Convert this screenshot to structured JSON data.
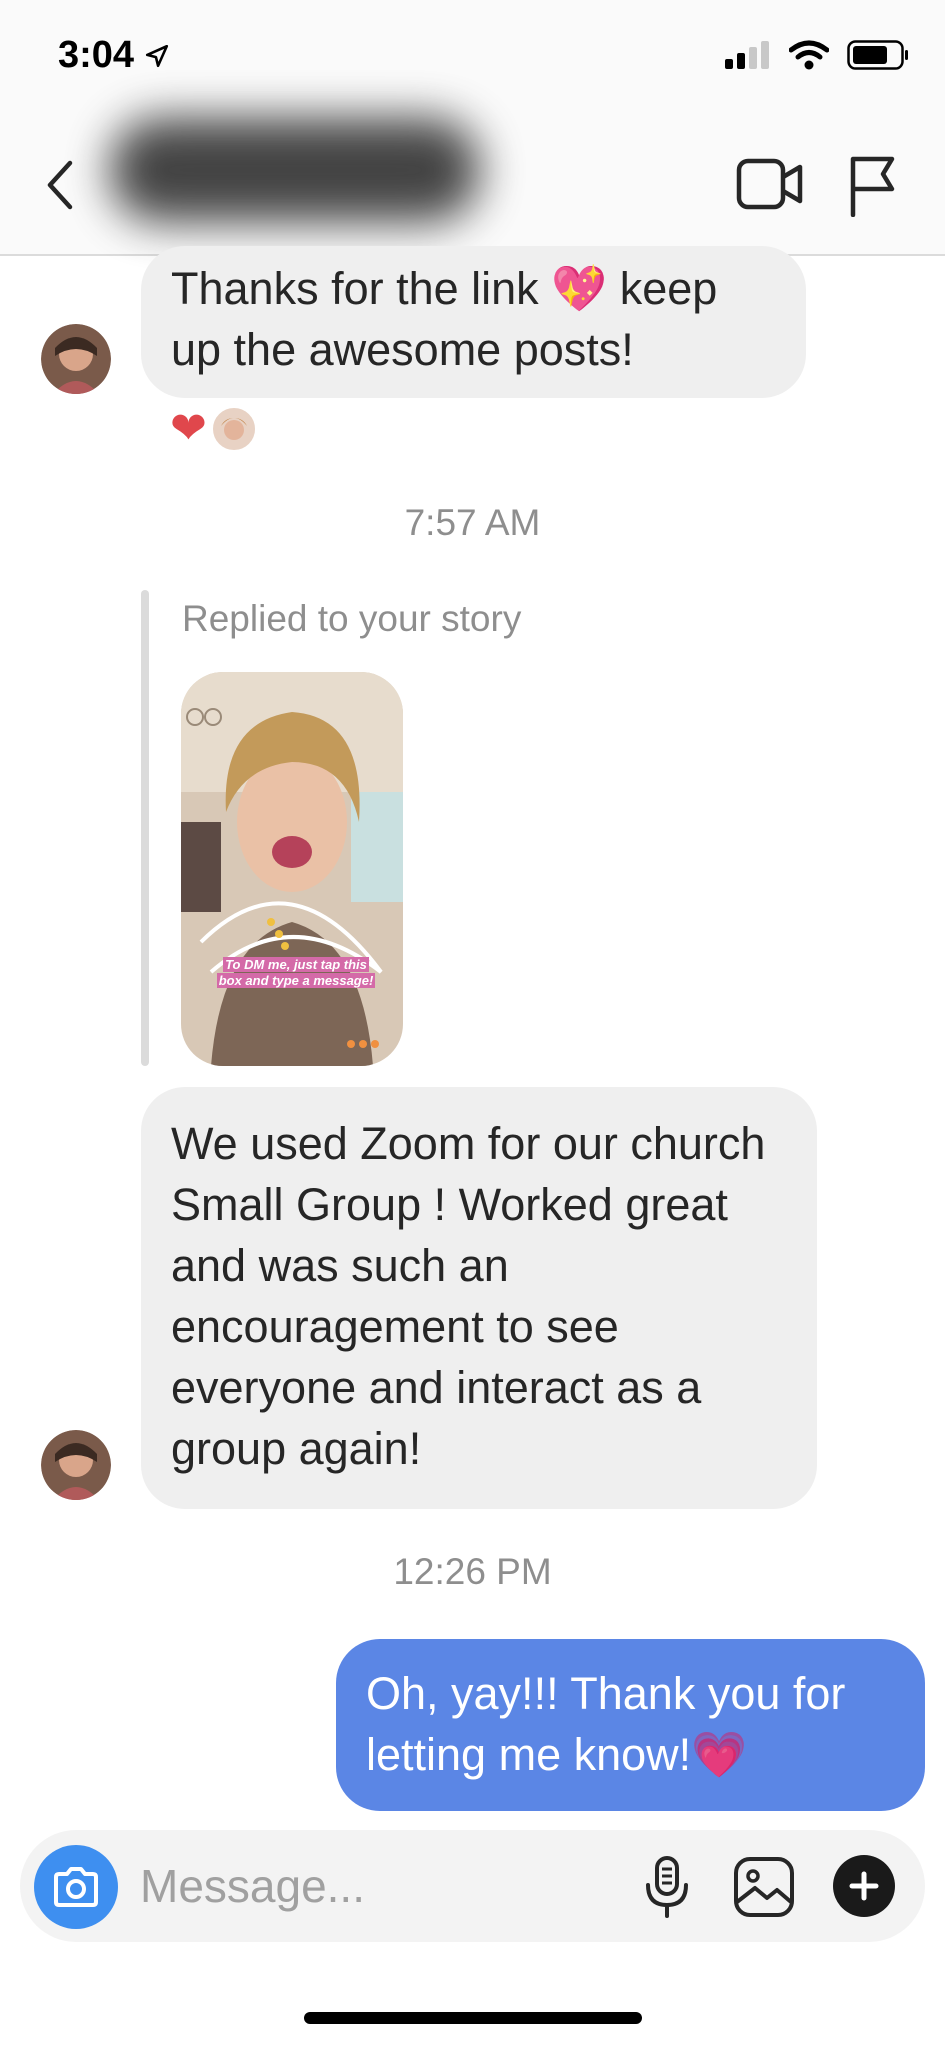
{
  "status_bar": {
    "time": "3:04"
  },
  "header": {
    "contact_name_blurred": ""
  },
  "messages": [
    {
      "id": "m1",
      "direction": "incoming",
      "text": "Thanks for the link 💖 keep up the awesome posts!",
      "reactions": [
        "❤"
      ]
    },
    {
      "id": "t1",
      "type": "timestamp",
      "text": "7:57 AM"
    },
    {
      "id": "m2",
      "direction": "incoming",
      "type": "story_reply",
      "label": "Replied to your story",
      "story_caption_line1": "To DM me, just tap this",
      "story_caption_line2": "box and type a message!"
    },
    {
      "id": "m3",
      "direction": "incoming",
      "text": "We used Zoom for our church Small Group ! Worked great and was such an encouragement to see everyone and interact as a group again!"
    },
    {
      "id": "t2",
      "type": "timestamp",
      "text": "12:26 PM"
    },
    {
      "id": "m4",
      "direction": "outgoing",
      "text": "Oh, yay!!! Thank you for letting me know!💗"
    }
  ],
  "composer": {
    "placeholder": "Message..."
  },
  "icons": {
    "back": "chevron-left-icon",
    "video": "video-camera-icon",
    "flag": "flag-icon",
    "camera": "camera-icon",
    "mic": "microphone-icon",
    "gallery": "image-gallery-icon",
    "plus": "plus-icon"
  },
  "colors": {
    "outgoing_bubble": "#5b86e5",
    "incoming_bubble": "#efefef",
    "camera_button": "#3e8ff0",
    "heart": "#e0474c"
  }
}
